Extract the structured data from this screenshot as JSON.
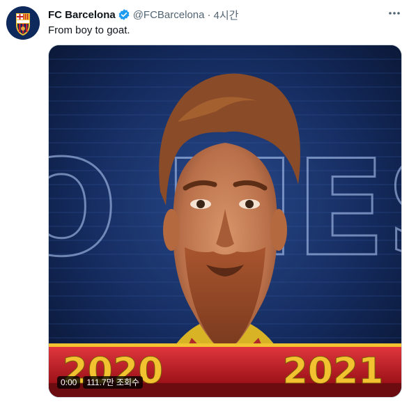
{
  "tweet": {
    "author_name": "FC Barcelona",
    "handle": "@FCBarcelona",
    "separator": "·",
    "time": "4시간",
    "text": "From boy to goat."
  },
  "icons": {
    "avatar": "fc-barcelona-crest-icon",
    "verified": "verified-badge-icon",
    "more": "more-options-icon"
  },
  "media": {
    "background_word": "LEO MESSI",
    "year_left": "2020",
    "year_right": "2021",
    "timestamp": "0:00",
    "views": "111.7만 조회수"
  },
  "colors": {
    "verified": "#1d9bf0",
    "year_band": "#c8202a",
    "year_text": "#f2c230",
    "media_bg": "#0b1a3a"
  }
}
